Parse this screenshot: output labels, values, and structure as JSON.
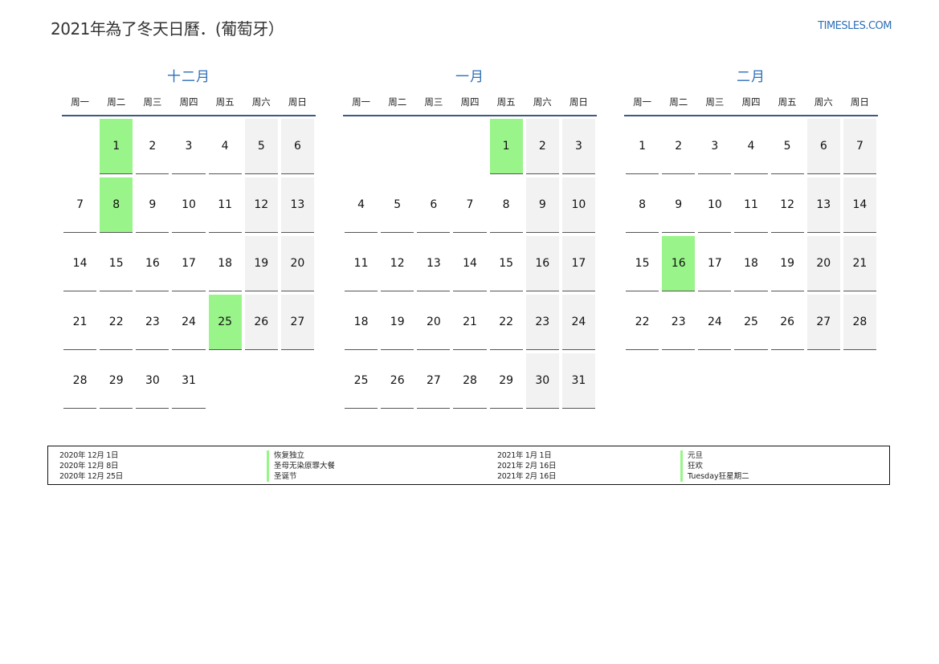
{
  "header": {
    "title": "2021年為了冬天日曆．(葡萄牙）",
    "site": "TIMESLES.COM"
  },
  "weekday_labels": [
    "周一",
    "周二",
    "周三",
    "周四",
    "周五",
    "周六",
    "周日"
  ],
  "colors": {
    "accent": "#2d6fb8",
    "holiday": "#99f58a",
    "weekend": "#f2f2f2",
    "rule": "#3d5a80"
  },
  "months": [
    {
      "name": "十二月",
      "weeks": [
        [
          {
            "d": "",
            "t": "empty"
          },
          {
            "d": "1",
            "t": "holiday"
          },
          {
            "d": "2",
            "t": ""
          },
          {
            "d": "3",
            "t": ""
          },
          {
            "d": "4",
            "t": ""
          },
          {
            "d": "5",
            "t": "weekend"
          },
          {
            "d": "6",
            "t": "weekend"
          }
        ],
        [
          {
            "d": "7",
            "t": ""
          },
          {
            "d": "8",
            "t": "holiday"
          },
          {
            "d": "9",
            "t": ""
          },
          {
            "d": "10",
            "t": ""
          },
          {
            "d": "11",
            "t": ""
          },
          {
            "d": "12",
            "t": "weekend"
          },
          {
            "d": "13",
            "t": "weekend"
          }
        ],
        [
          {
            "d": "14",
            "t": ""
          },
          {
            "d": "15",
            "t": ""
          },
          {
            "d": "16",
            "t": ""
          },
          {
            "d": "17",
            "t": ""
          },
          {
            "d": "18",
            "t": ""
          },
          {
            "d": "19",
            "t": "weekend"
          },
          {
            "d": "20",
            "t": "weekend"
          }
        ],
        [
          {
            "d": "21",
            "t": ""
          },
          {
            "d": "22",
            "t": ""
          },
          {
            "d": "23",
            "t": ""
          },
          {
            "d": "24",
            "t": ""
          },
          {
            "d": "25",
            "t": "holiday"
          },
          {
            "d": "26",
            "t": "weekend"
          },
          {
            "d": "27",
            "t": "weekend"
          }
        ],
        [
          {
            "d": "28",
            "t": ""
          },
          {
            "d": "29",
            "t": ""
          },
          {
            "d": "30",
            "t": ""
          },
          {
            "d": "31",
            "t": ""
          },
          {
            "d": "",
            "t": "empty"
          },
          {
            "d": "",
            "t": "empty"
          },
          {
            "d": "",
            "t": "empty"
          }
        ]
      ]
    },
    {
      "name": "一月",
      "weeks": [
        [
          {
            "d": "",
            "t": "empty"
          },
          {
            "d": "",
            "t": "empty"
          },
          {
            "d": "",
            "t": "empty"
          },
          {
            "d": "",
            "t": "empty"
          },
          {
            "d": "1",
            "t": "holiday"
          },
          {
            "d": "2",
            "t": "weekend"
          },
          {
            "d": "3",
            "t": "weekend"
          }
        ],
        [
          {
            "d": "4",
            "t": ""
          },
          {
            "d": "5",
            "t": ""
          },
          {
            "d": "6",
            "t": ""
          },
          {
            "d": "7",
            "t": ""
          },
          {
            "d": "8",
            "t": ""
          },
          {
            "d": "9",
            "t": "weekend"
          },
          {
            "d": "10",
            "t": "weekend"
          }
        ],
        [
          {
            "d": "11",
            "t": ""
          },
          {
            "d": "12",
            "t": ""
          },
          {
            "d": "13",
            "t": ""
          },
          {
            "d": "14",
            "t": ""
          },
          {
            "d": "15",
            "t": ""
          },
          {
            "d": "16",
            "t": "weekend"
          },
          {
            "d": "17",
            "t": "weekend"
          }
        ],
        [
          {
            "d": "18",
            "t": ""
          },
          {
            "d": "19",
            "t": ""
          },
          {
            "d": "20",
            "t": ""
          },
          {
            "d": "21",
            "t": ""
          },
          {
            "d": "22",
            "t": ""
          },
          {
            "d": "23",
            "t": "weekend"
          },
          {
            "d": "24",
            "t": "weekend"
          }
        ],
        [
          {
            "d": "25",
            "t": ""
          },
          {
            "d": "26",
            "t": ""
          },
          {
            "d": "27",
            "t": ""
          },
          {
            "d": "28",
            "t": ""
          },
          {
            "d": "29",
            "t": ""
          },
          {
            "d": "30",
            "t": "weekend"
          },
          {
            "d": "31",
            "t": "weekend"
          }
        ]
      ]
    },
    {
      "name": "二月",
      "weeks": [
        [
          {
            "d": "1",
            "t": ""
          },
          {
            "d": "2",
            "t": ""
          },
          {
            "d": "3",
            "t": ""
          },
          {
            "d": "4",
            "t": ""
          },
          {
            "d": "5",
            "t": ""
          },
          {
            "d": "6",
            "t": "weekend"
          },
          {
            "d": "7",
            "t": "weekend"
          }
        ],
        [
          {
            "d": "8",
            "t": ""
          },
          {
            "d": "9",
            "t": ""
          },
          {
            "d": "10",
            "t": ""
          },
          {
            "d": "11",
            "t": ""
          },
          {
            "d": "12",
            "t": ""
          },
          {
            "d": "13",
            "t": "weekend"
          },
          {
            "d": "14",
            "t": "weekend"
          }
        ],
        [
          {
            "d": "15",
            "t": ""
          },
          {
            "d": "16",
            "t": "holiday"
          },
          {
            "d": "17",
            "t": ""
          },
          {
            "d": "18",
            "t": ""
          },
          {
            "d": "19",
            "t": ""
          },
          {
            "d": "20",
            "t": "weekend"
          },
          {
            "d": "21",
            "t": "weekend"
          }
        ],
        [
          {
            "d": "22",
            "t": ""
          },
          {
            "d": "23",
            "t": ""
          },
          {
            "d": "24",
            "t": ""
          },
          {
            "d": "25",
            "t": ""
          },
          {
            "d": "26",
            "t": ""
          },
          {
            "d": "27",
            "t": "weekend"
          },
          {
            "d": "28",
            "t": "weekend"
          }
        ]
      ]
    }
  ],
  "holidays_left": [
    {
      "date": "2020年 12月 1日",
      "name": "恢复独立"
    },
    {
      "date": "2020年 12月 8日",
      "name": "圣母无染原罪大餐"
    },
    {
      "date": "2020年 12月 25日",
      "name": "圣诞节"
    }
  ],
  "holidays_right": [
    {
      "date": "2021年 1月 1日",
      "name": "元旦"
    },
    {
      "date": "2021年 2月 16日",
      "name": "狂欢"
    },
    {
      "date": "2021年 2月 16日",
      "name": "Tuesday狂星期二"
    }
  ]
}
